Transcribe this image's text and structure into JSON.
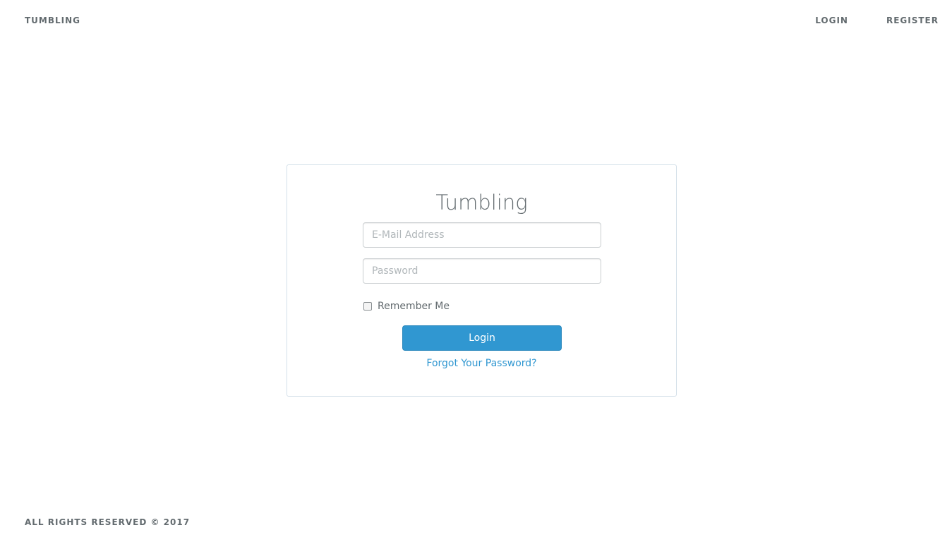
{
  "header": {
    "brand": "TUMBLING",
    "nav": {
      "login": "LOGIN",
      "register": "REGISTER"
    }
  },
  "login_card": {
    "title": "Tumbling",
    "email_placeholder": "E-Mail Address",
    "password_placeholder": "Password",
    "remember_label": "Remember Me",
    "login_button": "Login",
    "forgot_link": "Forgot Your Password?"
  },
  "footer": {
    "text": "ALL RIGHTS RESERVED © 2017"
  },
  "colors": {
    "primary": "#3097d1",
    "text": "#636b6f",
    "border": "#d3e0e9"
  }
}
